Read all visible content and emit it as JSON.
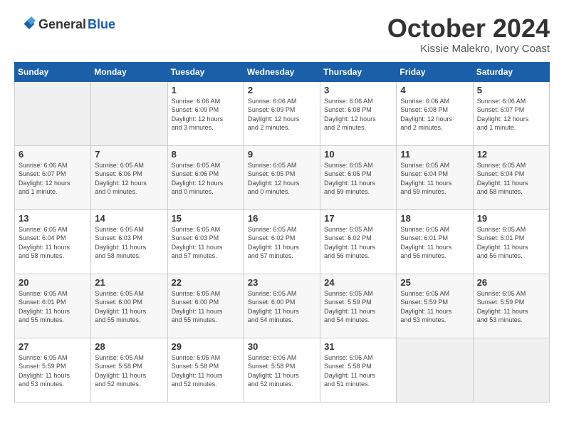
{
  "header": {
    "logo_line1": "General",
    "logo_line2": "Blue",
    "title": "October 2024",
    "subtitle": "Kissie Malekro, Ivory Coast"
  },
  "calendar": {
    "weekdays": [
      "Sunday",
      "Monday",
      "Tuesday",
      "Wednesday",
      "Thursday",
      "Friday",
      "Saturday"
    ],
    "weeks": [
      [
        {
          "day": "",
          "info": ""
        },
        {
          "day": "",
          "info": ""
        },
        {
          "day": "1",
          "info": "Sunrise: 6:06 AM\nSunset: 6:09 PM\nDaylight: 12 hours\nand 3 minutes."
        },
        {
          "day": "2",
          "info": "Sunrise: 6:06 AM\nSunset: 6:09 PM\nDaylight: 12 hours\nand 2 minutes."
        },
        {
          "day": "3",
          "info": "Sunrise: 6:06 AM\nSunset: 6:08 PM\nDaylight: 12 hours\nand 2 minutes."
        },
        {
          "day": "4",
          "info": "Sunrise: 6:06 AM\nSunset: 6:08 PM\nDaylight: 12 hours\nand 2 minutes."
        },
        {
          "day": "5",
          "info": "Sunrise: 6:06 AM\nSunset: 6:07 PM\nDaylight: 12 hours\nand 1 minute."
        }
      ],
      [
        {
          "day": "6",
          "info": "Sunrise: 6:06 AM\nSunset: 6:07 PM\nDaylight: 12 hours\nand 1 minute."
        },
        {
          "day": "7",
          "info": "Sunrise: 6:05 AM\nSunset: 6:06 PM\nDaylight: 12 hours\nand 0 minutes."
        },
        {
          "day": "8",
          "info": "Sunrise: 6:05 AM\nSunset: 6:06 PM\nDaylight: 12 hours\nand 0 minutes."
        },
        {
          "day": "9",
          "info": "Sunrise: 6:05 AM\nSunset: 6:05 PM\nDaylight: 12 hours\nand 0 minutes."
        },
        {
          "day": "10",
          "info": "Sunrise: 6:05 AM\nSunset: 6:05 PM\nDaylight: 11 hours\nand 59 minutes."
        },
        {
          "day": "11",
          "info": "Sunrise: 6:05 AM\nSunset: 6:04 PM\nDaylight: 11 hours\nand 59 minutes."
        },
        {
          "day": "12",
          "info": "Sunrise: 6:05 AM\nSunset: 6:04 PM\nDaylight: 11 hours\nand 58 minutes."
        }
      ],
      [
        {
          "day": "13",
          "info": "Sunrise: 6:05 AM\nSunset: 6:04 PM\nDaylight: 11 hours\nand 58 minutes."
        },
        {
          "day": "14",
          "info": "Sunrise: 6:05 AM\nSunset: 6:03 PM\nDaylight: 11 hours\nand 58 minutes."
        },
        {
          "day": "15",
          "info": "Sunrise: 6:05 AM\nSunset: 6:03 PM\nDaylight: 11 hours\nand 57 minutes."
        },
        {
          "day": "16",
          "info": "Sunrise: 6:05 AM\nSunset: 6:02 PM\nDaylight: 11 hours\nand 57 minutes."
        },
        {
          "day": "17",
          "info": "Sunrise: 6:05 AM\nSunset: 6:02 PM\nDaylight: 11 hours\nand 56 minutes."
        },
        {
          "day": "18",
          "info": "Sunrise: 6:05 AM\nSunset: 6:01 PM\nDaylight: 11 hours\nand 56 minutes."
        },
        {
          "day": "19",
          "info": "Sunrise: 6:05 AM\nSunset: 6:01 PM\nDaylight: 11 hours\nand 56 minutes."
        }
      ],
      [
        {
          "day": "20",
          "info": "Sunrise: 6:05 AM\nSunset: 6:01 PM\nDaylight: 11 hours\nand 55 minutes."
        },
        {
          "day": "21",
          "info": "Sunrise: 6:05 AM\nSunset: 6:00 PM\nDaylight: 11 hours\nand 55 minutes."
        },
        {
          "day": "22",
          "info": "Sunrise: 6:05 AM\nSunset: 6:00 PM\nDaylight: 11 hours\nand 55 minutes."
        },
        {
          "day": "23",
          "info": "Sunrise: 6:05 AM\nSunset: 6:00 PM\nDaylight: 11 hours\nand 54 minutes."
        },
        {
          "day": "24",
          "info": "Sunrise: 6:05 AM\nSunset: 5:59 PM\nDaylight: 11 hours\nand 54 minutes."
        },
        {
          "day": "25",
          "info": "Sunrise: 6:05 AM\nSunset: 5:59 PM\nDaylight: 11 hours\nand 53 minutes."
        },
        {
          "day": "26",
          "info": "Sunrise: 6:05 AM\nSunset: 5:59 PM\nDaylight: 11 hours\nand 53 minutes."
        }
      ],
      [
        {
          "day": "27",
          "info": "Sunrise: 6:05 AM\nSunset: 5:59 PM\nDaylight: 11 hours\nand 53 minutes."
        },
        {
          "day": "28",
          "info": "Sunrise: 6:05 AM\nSunset: 5:58 PM\nDaylight: 11 hours\nand 52 minutes."
        },
        {
          "day": "29",
          "info": "Sunrise: 6:05 AM\nSunset: 5:58 PM\nDaylight: 11 hours\nand 52 minutes."
        },
        {
          "day": "30",
          "info": "Sunrise: 6:06 AM\nSunset: 5:58 PM\nDaylight: 11 hours\nand 52 minutes."
        },
        {
          "day": "31",
          "info": "Sunrise: 6:06 AM\nSunset: 5:58 PM\nDaylight: 11 hours\nand 51 minutes."
        },
        {
          "day": "",
          "info": ""
        },
        {
          "day": "",
          "info": ""
        }
      ]
    ]
  }
}
